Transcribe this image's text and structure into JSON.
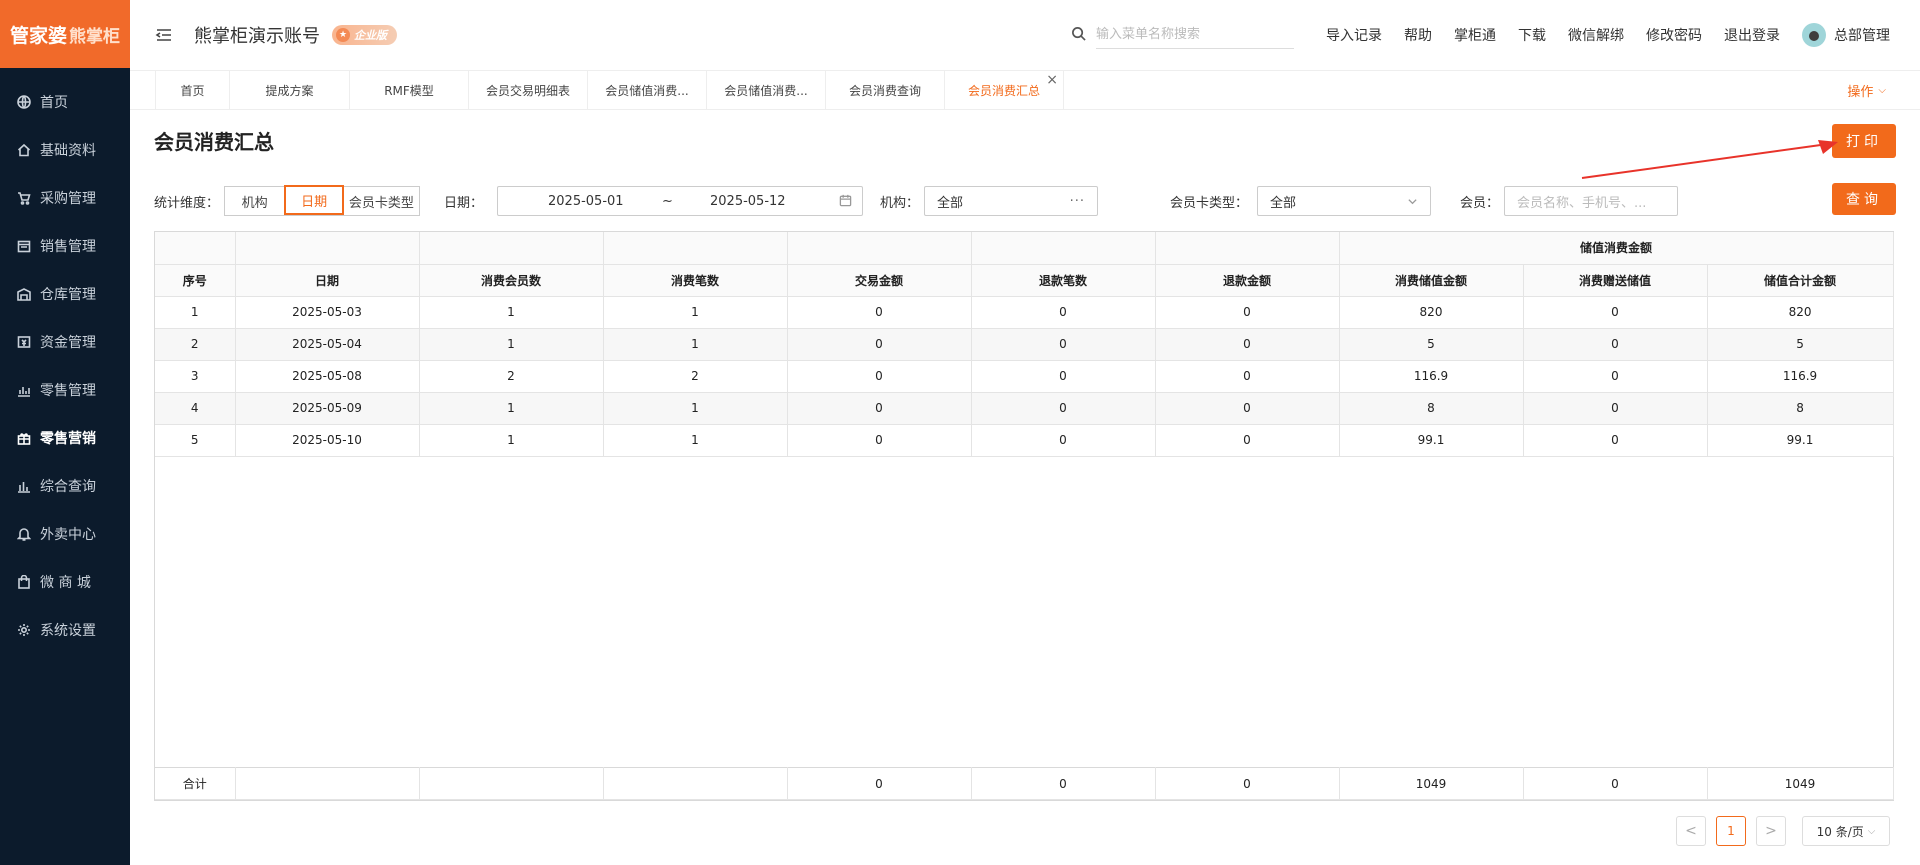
{
  "sidebar": {
    "logo_main": "管家婆",
    "logo_sub": "熊掌柜",
    "items": [
      {
        "label": "首页",
        "icon": "globe-icon"
      },
      {
        "label": "基础资料",
        "icon": "home-icon"
      },
      {
        "label": "采购管理",
        "icon": "cart-icon"
      },
      {
        "label": "销售管理",
        "icon": "calendar-icon"
      },
      {
        "label": "仓库管理",
        "icon": "warehouse-icon"
      },
      {
        "label": "资金管理",
        "icon": "money-icon"
      },
      {
        "label": "零售管理",
        "icon": "chart-icon"
      },
      {
        "label": "零售营销",
        "icon": "gift-icon",
        "active": true
      },
      {
        "label": "综合查询",
        "icon": "bar-chart-icon"
      },
      {
        "label": "外卖中心",
        "icon": "bell-icon"
      },
      {
        "label": "微 商 城",
        "icon": "bag-icon"
      },
      {
        "label": "系统设置",
        "icon": "gear-icon"
      }
    ]
  },
  "header": {
    "account_name": "熊掌柜演示账号",
    "badge": "企业版",
    "search_placeholder": "输入菜单名称搜索",
    "links": [
      "导入记录",
      "帮助",
      "掌柜通",
      "下载",
      "微信解绑",
      "修改密码",
      "退出登录"
    ],
    "user": "总部管理"
  },
  "tabs": {
    "items": [
      "首页",
      "提成方案",
      "RMF模型",
      "会员交易明细表",
      "会员储值消费...",
      "会员储值消费...",
      "会员消费查询",
      "会员消费汇总"
    ],
    "active_index": 7,
    "ops_label": "操作"
  },
  "page": {
    "title": "会员消费汇总",
    "print_label": "打印",
    "query_label": "查询"
  },
  "filters": {
    "dimension_label": "统计维度：",
    "dimension_options": [
      "机构",
      "日期",
      "会员卡类型"
    ],
    "dimension_selected": "日期",
    "date_label": "日期：",
    "date_start": "2025-05-01",
    "date_sep": "~",
    "date_end": "2025-05-12",
    "org_label": "机构：",
    "org_value": "全部",
    "org_more": "···",
    "cardtype_label": "会员卡类型：",
    "cardtype_value": "全部",
    "member_label": "会员：",
    "member_placeholder": "会员名称、手机号、..."
  },
  "table": {
    "group_header": "储值消费金额",
    "columns": [
      "序号",
      "日期",
      "消费会员数",
      "消费笔数",
      "交易金额",
      "退款笔数",
      "退款金额",
      "消费储值金额",
      "消费赠送储值",
      "储值合计金额"
    ],
    "rows": [
      [
        "1",
        "2025-05-03",
        "1",
        "1",
        "0",
        "0",
        "0",
        "820",
        "0",
        "820"
      ],
      [
        "2",
        "2025-05-04",
        "1",
        "1",
        "0",
        "0",
        "0",
        "5",
        "0",
        "5"
      ],
      [
        "3",
        "2025-05-08",
        "2",
        "2",
        "0",
        "0",
        "0",
        "116.9",
        "0",
        "116.9"
      ],
      [
        "4",
        "2025-05-09",
        "1",
        "1",
        "0",
        "0",
        "0",
        "8",
        "0",
        "8"
      ],
      [
        "5",
        "2025-05-10",
        "1",
        "1",
        "0",
        "0",
        "0",
        "99.1",
        "0",
        "99.1"
      ]
    ],
    "footer": [
      "合计",
      "",
      "",
      "",
      "0",
      "0",
      "0",
      "1049",
      "0",
      "1049"
    ]
  },
  "pagination": {
    "prev": "<",
    "current": "1",
    "next": ">",
    "page_size": "10 条/页"
  },
  "colors": {
    "accent": "#f26a1b",
    "sidebar_bg": "#0c1b2c",
    "logo_bg": "#f16a2a"
  }
}
